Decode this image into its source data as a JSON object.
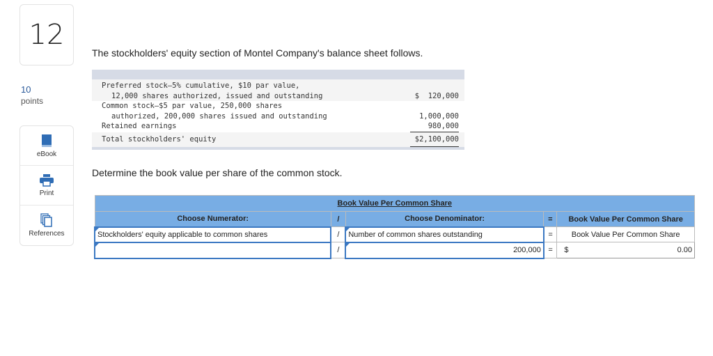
{
  "question": {
    "number": "12",
    "points_value": "10",
    "points_label": "points"
  },
  "tools": [
    {
      "label": "eBook",
      "icon": "book-icon"
    },
    {
      "label": "Print",
      "icon": "printer-icon"
    },
    {
      "label": "References",
      "icon": "documents-icon"
    }
  ],
  "prompt": "The stockholders' equity section of Montel Company's balance sheet follows.",
  "balance_sheet": {
    "rows": [
      {
        "line1": "Preferred stock—5% cumulative, $10 par value,",
        "line2": "  12,000 shares authorized, issued and outstanding",
        "amount": "$  120,000"
      },
      {
        "line1": "Common stock—$5 par value, 250,000 shares",
        "line2": "  authorized, 200,000 shares issued and outstanding",
        "amount": "1,000,000"
      },
      {
        "line1": "Retained earnings",
        "amount": "980,000"
      },
      {
        "line1": "Total stockholders' equity",
        "amount": "$2,100,000"
      }
    ]
  },
  "instruction": "Determine the book value per share of the common stock.",
  "answer_table": {
    "title": "Book Value Per Common Share",
    "headers": {
      "numerator": "Choose Numerator:",
      "slash": "/",
      "denominator": "Choose Denominator:",
      "equals": "=",
      "result": "Book Value Per Common Share"
    },
    "row1": {
      "numerator": "Stockholders' equity applicable to common shares",
      "slash": "/",
      "denominator": "Number of common shares outstanding",
      "equals": "=",
      "result": "Book Value Per Common Share"
    },
    "row2": {
      "numerator": "",
      "slash": "/",
      "denominator": "200,000",
      "equals": "=",
      "currency": "$",
      "result": "0.00"
    }
  }
}
